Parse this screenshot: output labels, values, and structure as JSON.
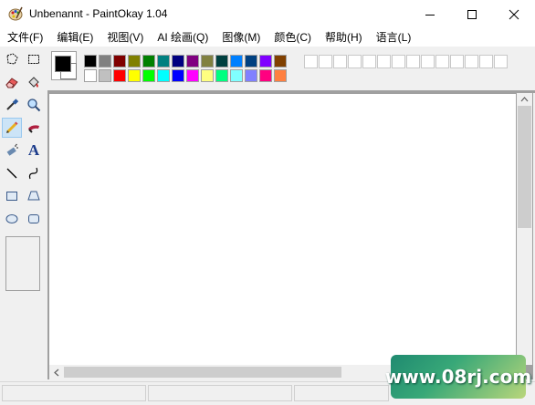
{
  "window": {
    "title": "Unbenannt - PaintOkay 1.04"
  },
  "menu": [
    "文件(F)",
    "编辑(E)",
    "视图(V)",
    "AI 绘画(Q)",
    "图像(M)",
    "颜色(C)",
    "帮助(H)",
    "语言(L)"
  ],
  "tools": [
    {
      "name": "free-select-icon"
    },
    {
      "name": "rect-select-icon"
    },
    {
      "name": "eraser-icon"
    },
    {
      "name": "fill-bucket-icon"
    },
    {
      "name": "color-picker-icon"
    },
    {
      "name": "magnifier-icon"
    },
    {
      "name": "pencil-icon",
      "active": true
    },
    {
      "name": "brush-icon"
    },
    {
      "name": "airbrush-icon"
    },
    {
      "name": "text-icon"
    },
    {
      "name": "line-icon"
    },
    {
      "name": "curve-icon"
    },
    {
      "name": "rectangle-icon"
    },
    {
      "name": "polygon-icon"
    },
    {
      "name": "ellipse-icon"
    },
    {
      "name": "rounded-rect-icon"
    }
  ],
  "text_tool_glyph": "A",
  "palette": {
    "foreground": "#000000",
    "background": "#ffffff",
    "row1": [
      "#000000",
      "#808080",
      "#800000",
      "#808000",
      "#008000",
      "#008080",
      "#000080",
      "#800080",
      "#808040",
      "#004040",
      "#0080ff",
      "#004080",
      "#8000ff",
      "#804000"
    ],
    "row2": [
      "#ffffff",
      "#c0c0c0",
      "#ff0000",
      "#ffff00",
      "#00ff00",
      "#00ffff",
      "#0000ff",
      "#ff00ff",
      "#ffff80",
      "#00ff80",
      "#80ffff",
      "#8080ff",
      "#ff0080",
      "#ff8040"
    ]
  },
  "watermark": "www.08rj.com"
}
